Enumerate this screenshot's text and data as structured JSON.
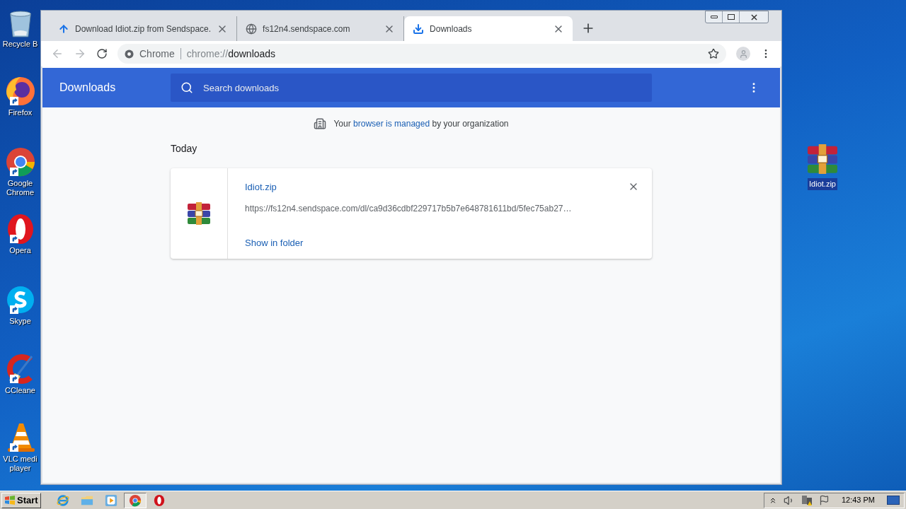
{
  "desktop": {
    "icons": [
      {
        "kind": "recycle",
        "label": "Recycle B"
      },
      {
        "kind": "firefox",
        "label": "Firefox"
      },
      {
        "kind": "chrome",
        "label": "Google Chrome"
      },
      {
        "kind": "opera",
        "label": "Opera"
      },
      {
        "kind": "skype",
        "label": "Skype"
      },
      {
        "kind": "ccleaner",
        "label": "CCleane"
      },
      {
        "kind": "vlc",
        "label": "VLC medi player"
      }
    ],
    "file_icon": {
      "label": "Idiot.zip",
      "selected": true
    }
  },
  "browser": {
    "tabs": [
      {
        "kind": "upload",
        "title": "Download Idiot.zip from Sendspace.",
        "selected": false
      },
      {
        "kind": "globe",
        "title": "fs12n4.sendspace.com",
        "selected": false
      },
      {
        "kind": "download",
        "title": "Downloads",
        "selected": true
      }
    ],
    "omnibox": {
      "scheme_label": "Chrome",
      "url_prefix": "chrome://",
      "url_path": "downloads"
    },
    "page": {
      "title": "Downloads",
      "search": {
        "placeholder": "Search downloads"
      },
      "notice": {
        "before": "Your",
        "link": "browser is managed",
        "after": "by your organization"
      },
      "section": "Today",
      "items": [
        {
          "file_name": "Idiot.zip",
          "url": "https://fs12n4.sendspace.com/dl/ca9d36cdbf229717b5b7e648781611bd/5fec75ab27…",
          "action": "Show in folder"
        }
      ]
    }
  },
  "taskbar": {
    "start": "Start",
    "apps": [
      {
        "kind": "ie",
        "pressed": false
      },
      {
        "kind": "explorer",
        "pressed": false
      },
      {
        "kind": "media",
        "pressed": false
      },
      {
        "kind": "chrome",
        "pressed": true
      },
      {
        "kind": "opera",
        "pressed": false
      }
    ],
    "clock": "12:43 PM"
  }
}
